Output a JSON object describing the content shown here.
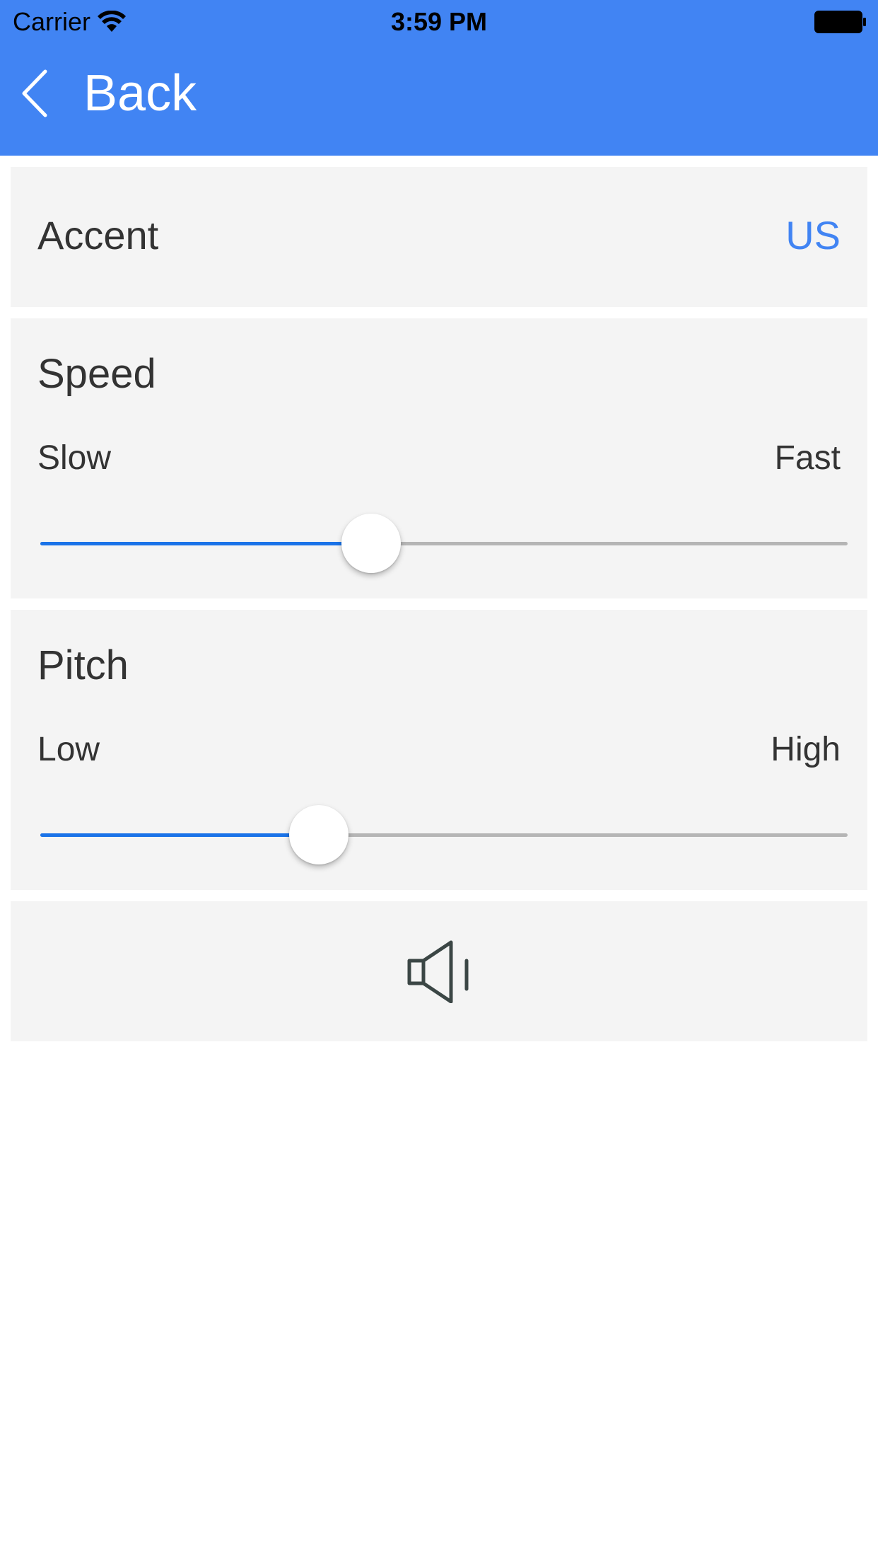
{
  "status_bar": {
    "carrier": "Carrier",
    "time": "3:59 PM",
    "wifi_icon": "wifi-icon",
    "battery_icon": "battery-icon"
  },
  "nav": {
    "back_label": "Back",
    "back_icon": "chevron-left-icon",
    "background_color": "#4184f3"
  },
  "accent": {
    "label": "Accent",
    "value": "US",
    "value_color": "#4184f3"
  },
  "speed": {
    "title": "Speed",
    "min_label": "Slow",
    "max_label": "Fast",
    "value": 0.41
  },
  "pitch": {
    "title": "Pitch",
    "min_label": "Low",
    "max_label": "High",
    "value": 0.345
  },
  "play": {
    "icon": "speaker-icon"
  },
  "colors": {
    "accent": "#4184f3",
    "slider_active": "#1a73e8",
    "slider_inactive": "#b5b5b5",
    "card_background": "#f4f4f4"
  }
}
